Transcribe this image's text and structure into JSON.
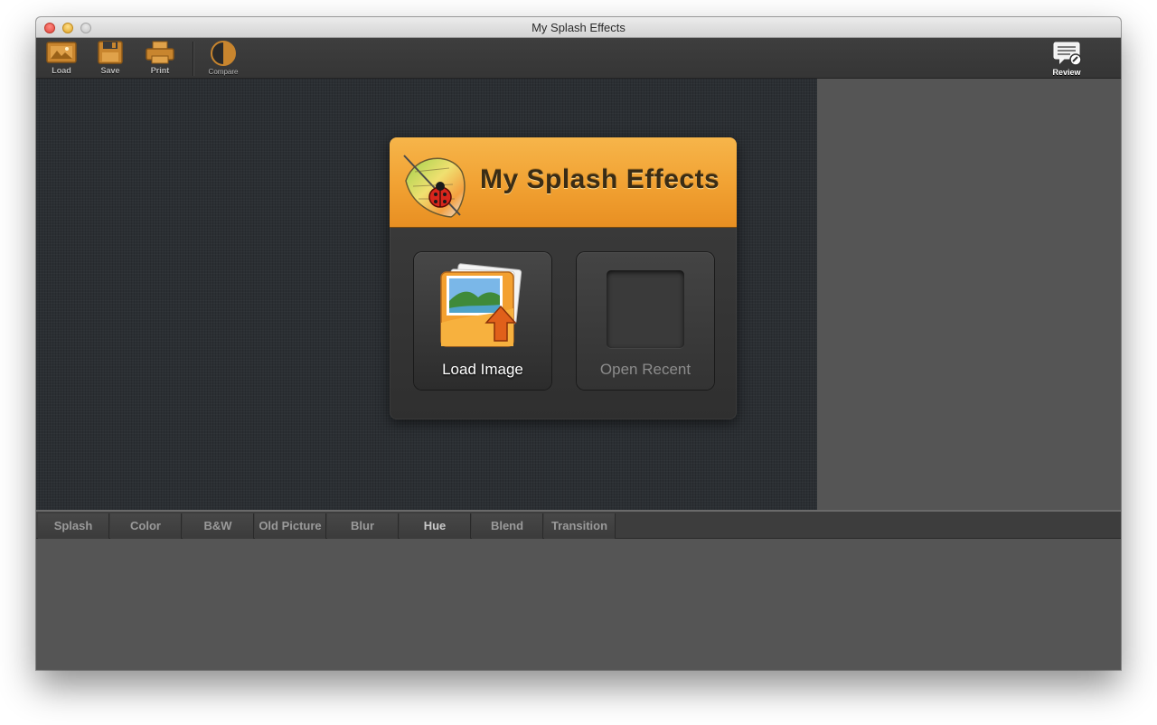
{
  "window": {
    "title": "My Splash Effects"
  },
  "toolbar": {
    "load_label": "Load",
    "save_label": "Save",
    "print_label": "Print",
    "compare_label": "Compare",
    "review_label": "Review"
  },
  "splash": {
    "title": "My Splash Effects",
    "load_label": "Load Image",
    "recent_label": "Open Recent"
  },
  "tabs": [
    {
      "label": "Splash"
    },
    {
      "label": "Color"
    },
    {
      "label": "B&W"
    },
    {
      "label": "Old Picture"
    },
    {
      "label": "Blur"
    },
    {
      "label": "Hue"
    },
    {
      "label": "Blend"
    },
    {
      "label": "Transition"
    }
  ],
  "active_tab": "Hue",
  "colors": {
    "accent": "#f1a132",
    "toolbar_icon": "#c8852e",
    "canvas": "#2b2f33",
    "panel": "#555555"
  },
  "icons": {
    "load": "load-icon",
    "save": "save-icon",
    "print": "print-icon",
    "compare": "compare-icon",
    "review": "review-icon",
    "logo": "leaf-ladybug-logo",
    "load_image": "photo-upload-icon"
  }
}
